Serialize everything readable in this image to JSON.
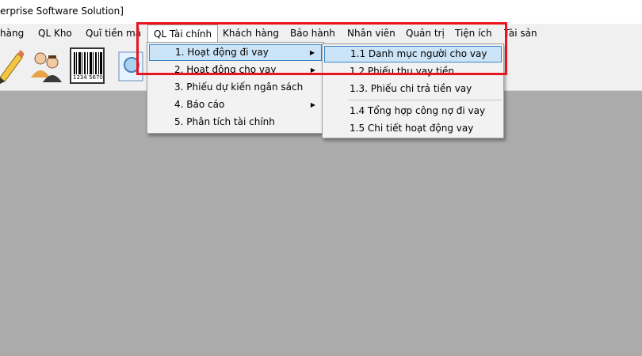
{
  "window": {
    "title": "erprise Software Solution]"
  },
  "menubar": {
    "items": [
      {
        "label": "hàng"
      },
      {
        "label": "QL Kho"
      },
      {
        "label": "Quĩ tiền mặ"
      },
      {
        "label": "QL Tài chính"
      },
      {
        "label": "Khách hàng"
      },
      {
        "label": "Bảo hành"
      },
      {
        "label": "Nhân viên"
      },
      {
        "label": "Quản trị"
      },
      {
        "label": "Tiện ích"
      },
      {
        "label": "Tài sản"
      }
    ]
  },
  "toolbar": {
    "icons": [
      "pencil-icon",
      "users-icon",
      "barcode-icon",
      "document-icon"
    ],
    "barcode_text": "1234 5670"
  },
  "finance_menu": {
    "items": [
      {
        "label": "1. Hoạt động đi vay"
      },
      {
        "label": "2. Hoạt động cho vay"
      },
      {
        "label": "3. Phiếu dự kiến ngân sách"
      },
      {
        "label": "4. Báo cáo"
      },
      {
        "label": "5. Phân tích tài chính"
      }
    ]
  },
  "borrow_submenu": {
    "items": [
      {
        "label": "1.1 Danh mục người cho vay"
      },
      {
        "label": "1.2 Phiếu thu vay tiền"
      },
      {
        "label": "1.3. Phiếu chi trả tiền vay"
      },
      {
        "label": "1.4 Tổng hợp công nợ đi vay"
      },
      {
        "label": "1.5 Chi tiết hoạt động vay"
      }
    ]
  },
  "colors": {
    "highlight": "#e8141e",
    "hover": "#cce4f7",
    "workspace": "#ababab"
  }
}
